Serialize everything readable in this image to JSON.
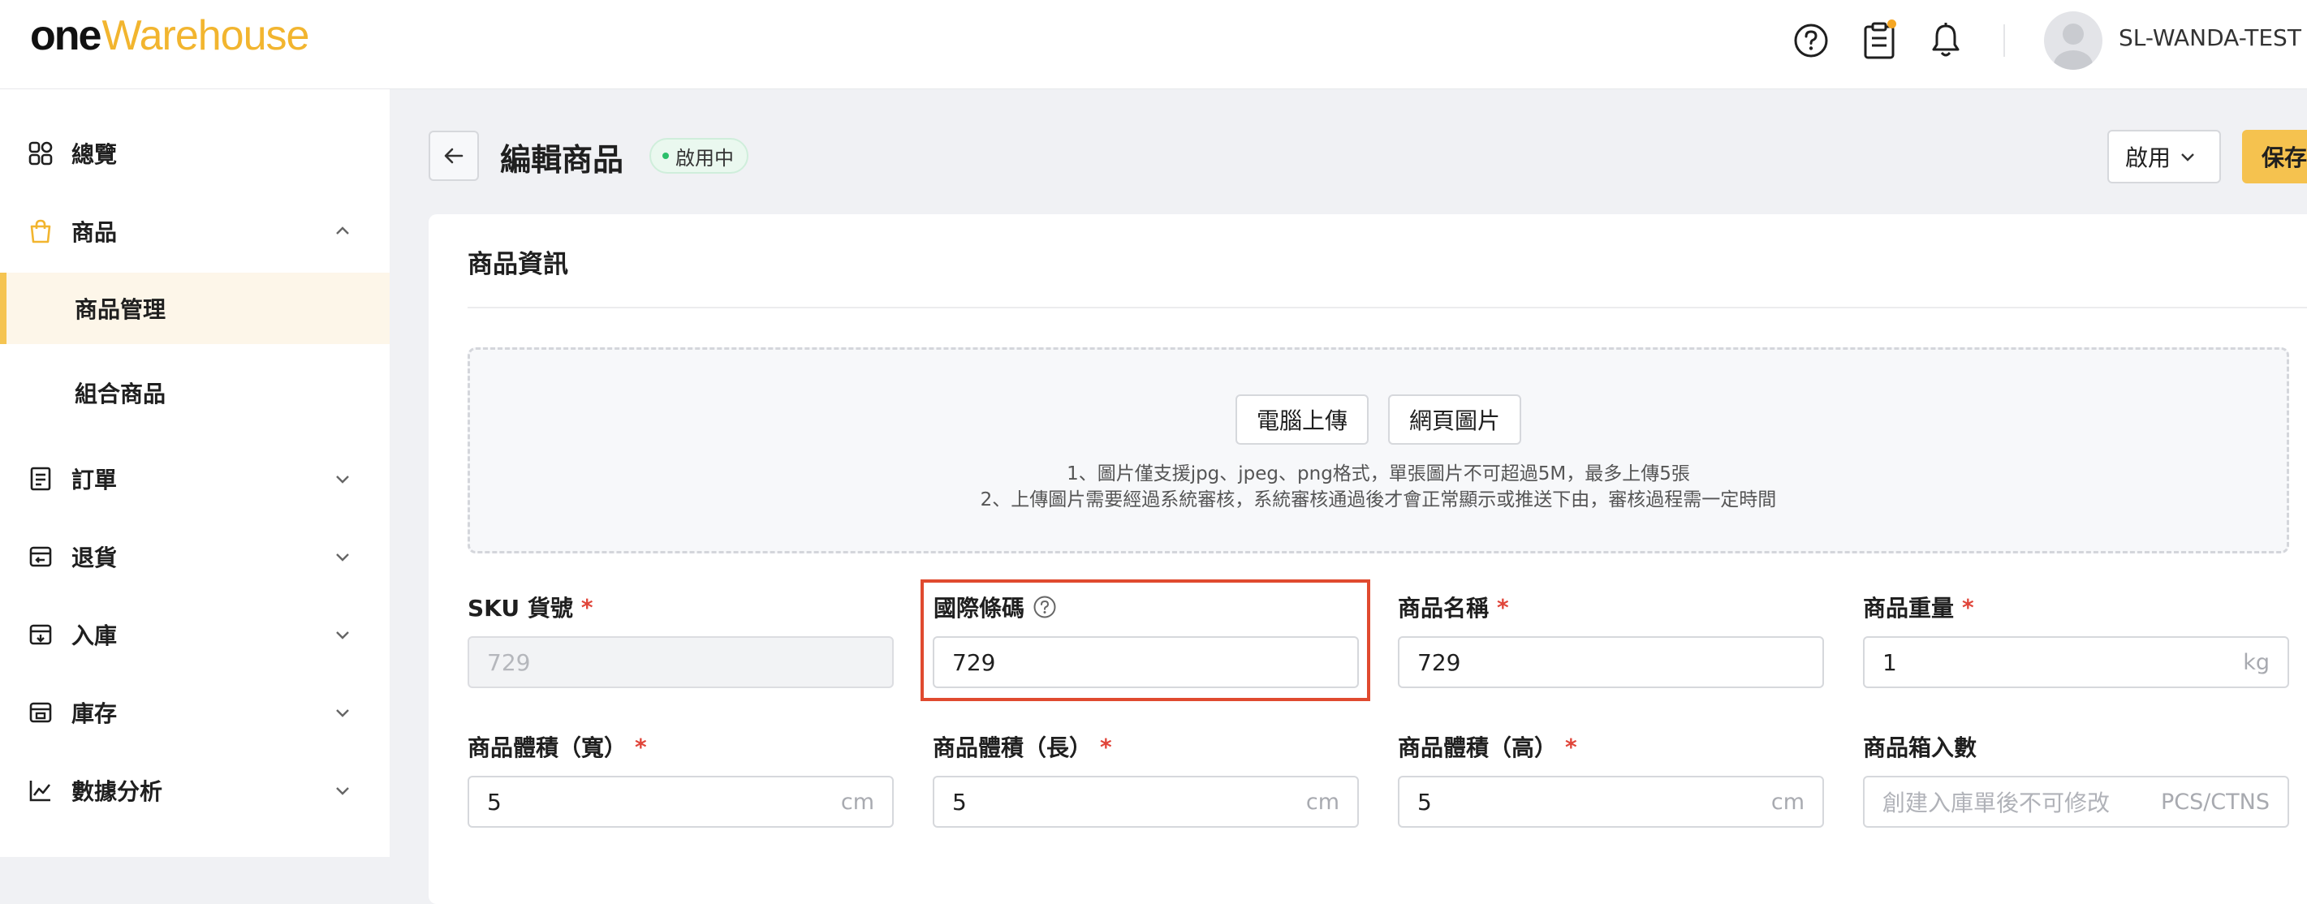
{
  "header": {
    "logo_one": "one",
    "logo_warehouse": "Warehouse",
    "icons": [
      "help-circle-icon",
      "clipboard-icon",
      "bell-icon"
    ],
    "notification_dot_color": "#f5a623",
    "username": "SL-WANDA-TEST"
  },
  "sidebar": {
    "items": [
      {
        "label": "總覽",
        "icon": "grid-icon",
        "expandable": false
      },
      {
        "label": "商品",
        "icon": "bag-icon",
        "expandable": true,
        "expanded": true
      },
      {
        "label": "商品管理",
        "sub": true,
        "active": true
      },
      {
        "label": "組合商品",
        "sub": true
      },
      {
        "label": "訂單",
        "icon": "order-list-icon",
        "expandable": true
      },
      {
        "label": "退貨",
        "icon": "return-icon",
        "expandable": true
      },
      {
        "label": "入庫",
        "icon": "inbound-icon",
        "expandable": true
      },
      {
        "label": "庫存",
        "icon": "inventory-icon",
        "expandable": true
      },
      {
        "label": "數據分析",
        "icon": "analytics-icon",
        "expandable": true
      }
    ],
    "active_color": "#f5c451"
  },
  "page": {
    "title": "編輯商品",
    "status_badge": "啟用中",
    "status_select": "啟用",
    "save_label": "保存"
  },
  "card": {
    "title": "商品資訊",
    "upload": {
      "computer_button": "電腦上傳",
      "web_button": "網頁圖片",
      "hint_1": "1、圖片僅支援jpg、jpeg、png格式，單張圖片不可超過5M，最多上傳5張",
      "hint_2": "2、上傳圖片需要經過系統審核，系統審核通過後才會正常顯示或推送下由，審核過程需一定時間"
    }
  },
  "form": {
    "sku": {
      "label": "SKU 貨號",
      "required": true,
      "value": "729",
      "disabled": true
    },
    "barcode": {
      "label": "國際條碼",
      "help": true,
      "value": "729",
      "highlighted": true
    },
    "name": {
      "label": "商品名稱",
      "required": true,
      "value": "729"
    },
    "weight": {
      "label": "商品重量",
      "required": true,
      "value": "1",
      "unit": "kg"
    },
    "width": {
      "label": "商品體積（寬）",
      "required": true,
      "value": "5",
      "unit": "cm"
    },
    "length": {
      "label": "商品體積（長）",
      "required": true,
      "value": "5",
      "unit": "cm"
    },
    "height": {
      "label": "商品體積（高）",
      "required": true,
      "value": "5",
      "unit": "cm"
    },
    "box_qty": {
      "label": "商品箱入數",
      "placeholder": "創建入庫單後不可修改",
      "unit": "PCS/CTNS"
    }
  }
}
